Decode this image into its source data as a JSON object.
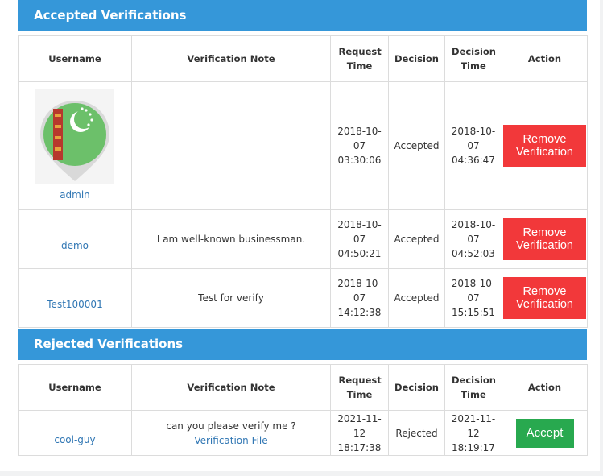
{
  "accepted": {
    "title": "Accepted Verifications",
    "headers": {
      "username": "Username",
      "note": "Verification Note",
      "request": "Request Time",
      "decision": "Decision",
      "decision_time": "Decision Time",
      "action": "Action"
    },
    "rows": [
      {
        "username": "admin",
        "note": "",
        "request": "2018-10-07 03:30:06",
        "decision": "Accepted",
        "decision_time": "2018-10-07 04:36:47",
        "action": "Remove Verification"
      },
      {
        "username": "demo",
        "note": "I am well-known businessman.",
        "request": "2018-10-07 04:50:21",
        "decision": "Accepted",
        "decision_time": "2018-10-07 04:52:03",
        "action": "Remove Verification"
      },
      {
        "username": "Test100001",
        "note": "Test for verify",
        "request": "2018-10-07 14:12:38",
        "decision": "Accepted",
        "decision_time": "2018-10-07 15:15:51",
        "action": "Remove Verification"
      }
    ]
  },
  "rejected": {
    "title": "Rejected Verifications",
    "headers": {
      "username": "Username",
      "note": "Verification Note",
      "request": "Request Time",
      "decision": "Decision",
      "decision_time": "Decision Time",
      "action": "Action"
    },
    "rows": [
      {
        "username": "cool-guy",
        "note": "can you please verify me ?",
        "file_link": "Verification File",
        "request": "2021-11-12 18:17:38",
        "decision": "Rejected",
        "decision_time": "2021-11-12 18:19:17",
        "action": "Accept"
      }
    ]
  },
  "colors": {
    "header": "#3597d9",
    "remove": "#f2383a",
    "accept": "#28a94f",
    "link": "#3177b4"
  },
  "icons": {
    "avatar": "turkmenistan-flag-map-pin"
  }
}
